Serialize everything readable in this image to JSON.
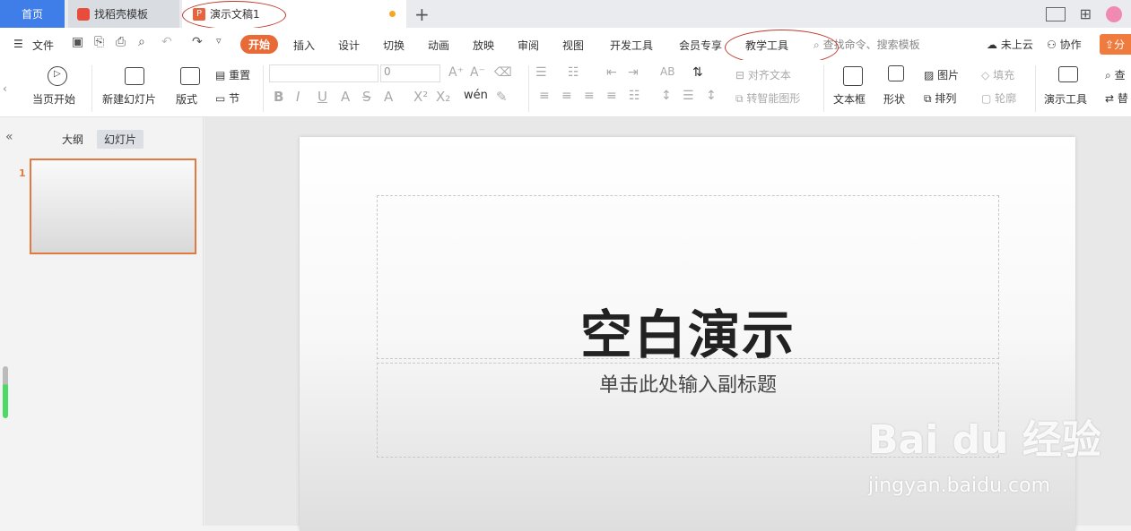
{
  "tabs": {
    "home": "首页",
    "template": "找稻壳模板",
    "document": "演示文稿1",
    "add": "+"
  },
  "menu": {
    "file": "文件",
    "items": [
      "开始",
      "插入",
      "设计",
      "切换",
      "动画",
      "放映",
      "审阅",
      "视图",
      "开发工具",
      "会员专享",
      "教学工具"
    ],
    "search_placeholder": "查找命令、搜索模板",
    "cloud": "未上云",
    "collab": "协作",
    "share": "分"
  },
  "ribbon": {
    "play_current": "当页开始",
    "new_slide": "新建幻灯片",
    "layout": "版式",
    "reset": "重置",
    "section": "节",
    "font_size": "0",
    "align_text": "对齐文本",
    "smart_graphic": "转智能图形",
    "textbox": "文本框",
    "shape": "形状",
    "picture": "图片",
    "arrange": "排列",
    "fill": "填充",
    "outline": "轮廓",
    "present_tools": "演示工具",
    "find": "查",
    "replace": "替"
  },
  "panel": {
    "outline_tab": "大纲",
    "slides_tab": "幻灯片",
    "slide_number": "1"
  },
  "slide": {
    "title": "空白演示",
    "subtitle": "单击此处输入副标题"
  },
  "watermark": {
    "brand": "Bai du 经验",
    "url": "jingyan.baidu.com"
  },
  "colors": {
    "accent": "#e86a36",
    "home_tab": "#3f7de8",
    "annotation": "#c0392b"
  }
}
